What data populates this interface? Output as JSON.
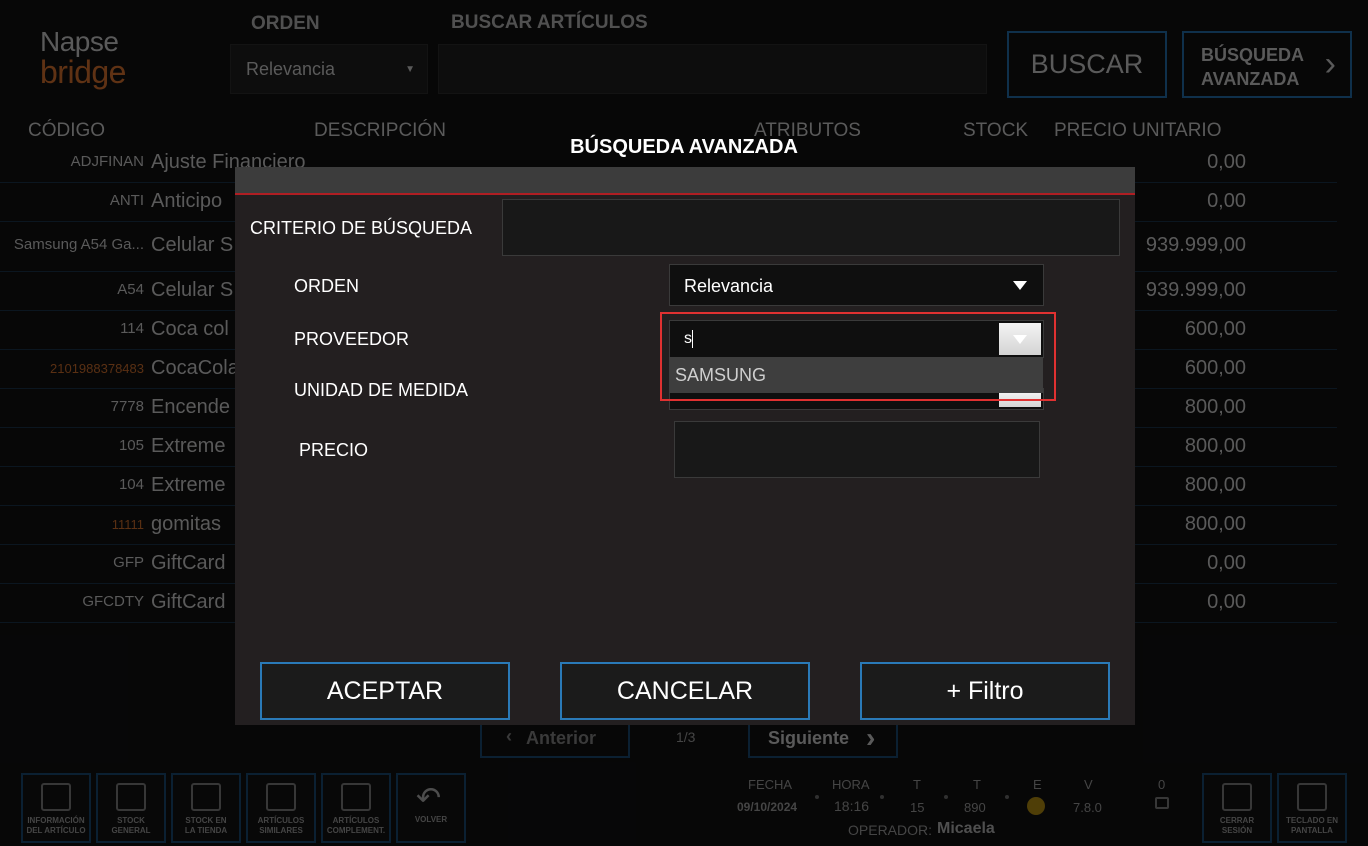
{
  "brand": {
    "line1": "Napse",
    "line2": "bridge"
  },
  "header": {
    "orden_label": "ORDEN",
    "orden_value": "Relevancia",
    "buscar_label": "BUSCAR ARTÍCULOS",
    "buscar_button": "BUSCAR",
    "advanced_line1": "BÚSQUEDA",
    "advanced_line2": "AVANZADA",
    "chevron": "›"
  },
  "table": {
    "columns": [
      "CÓDIGO",
      "DESCRIPCIÓN",
      "ATRIBUTOS",
      "STOCK",
      "PRECIO UNITARIO"
    ],
    "rows": [
      {
        "code": "ADJFINAN",
        "desc": "Ajuste Financiero",
        "price": "0,00"
      },
      {
        "code": "ANTI",
        "desc": "Anticipo",
        "price": "0,00"
      },
      {
        "code": "Samsung A54 Ga...",
        "desc": "Celular S",
        "price": "939.999,00"
      },
      {
        "code": "A54",
        "desc": "Celular S",
        "price": "939.999,00"
      },
      {
        "code": "114",
        "desc": "Coca col",
        "price": "600,00"
      },
      {
        "code": "2101988378483",
        "desc": "CocaCola",
        "price": "600,00"
      },
      {
        "code": "7778",
        "desc": "Encende",
        "price": "800,00"
      },
      {
        "code": "105",
        "desc": "Extreme",
        "price": "800,00"
      },
      {
        "code": "104",
        "desc": "Extreme",
        "price": "800,00"
      },
      {
        "code": "11111",
        "desc": "gomitas",
        "price": "800,00"
      },
      {
        "code": "GFP",
        "desc": "GiftCard",
        "price": "0,00"
      },
      {
        "code": "GFCDTY",
        "desc": "GiftCard",
        "price": "0,00"
      }
    ]
  },
  "pager": {
    "prev": "Anterior",
    "page": "1/3",
    "next": "Siguiente"
  },
  "toolbar": [
    {
      "label1": "INFORMACIÓN",
      "label2": "DEL ARTÍCULO"
    },
    {
      "label1": "STOCK",
      "label2": "GENERAL"
    },
    {
      "label1": "STOCK EN",
      "label2": "LA TIENDA"
    },
    {
      "label1": "ARTÍCULOS",
      "label2": "SIMILARES"
    },
    {
      "label1": "ARTÍCULOS",
      "label2": "COMPLEMENT."
    },
    {
      "label1": "VOLVER",
      "label2": ""
    }
  ],
  "status": {
    "fecha_label": "FECHA",
    "fecha": "09/10/2024",
    "hora_label": "HORA",
    "hora": "18:16",
    "t1_label": "T",
    "t1": "15",
    "t2_label": "T",
    "t2": "890",
    "e_label": "E",
    "v_label": "V",
    "v": "7.8.0",
    "count": "0",
    "operador_label": "OPERADOR:",
    "operador": "Micaela"
  },
  "right_toolbar": [
    {
      "label1": "CERRAR",
      "label2": "SESIÓN"
    },
    {
      "label1": "TECLADO EN",
      "label2": "PANTALLA"
    }
  ],
  "modal": {
    "title": "BÚSQUEDA AVANZADA",
    "criterio_label": "CRITERIO DE BÚSQUEDA",
    "criterio_value": "",
    "orden_label": "ORDEN",
    "orden_value": "Relevancia",
    "proveedor_label": "PROVEEDOR",
    "proveedor_value": "s",
    "proveedor_option": "SAMSUNG",
    "unidad_label": "UNIDAD DE MEDIDA",
    "precio_label": "PRECIO",
    "precio_value": "",
    "aceptar": "ACEPTAR",
    "cancelar": "CANCELAR",
    "filtro": "+ Filtro"
  },
  "colors": {
    "accent_blue": "#2a7ab8",
    "modal_red": "#b01e23",
    "highlight_red": "#e03131",
    "status_dot": "#9a7a10"
  }
}
